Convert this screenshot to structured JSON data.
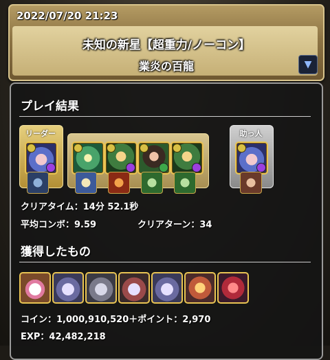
{
  "header": {
    "datetime": "2022/07/20 21:23",
    "dungeon_title": "未知の新星【超重力/ノーコン】",
    "floor_name": "業炎の百龍",
    "expand_icon": "triangle-down-icon"
  },
  "result": {
    "section_title": "プレイ結果",
    "leader_tag": "リーダー",
    "helper_tag": "助っ人",
    "clear_time": "クリアタイム：14分 52.1秒",
    "avg_combo": "平均コンボ：9.59",
    "clear_turns": "クリアターン：34"
  },
  "loot": {
    "section_title": "獲得したもの",
    "coin": "コイン：1,000,910,520＋ポイント：2,970",
    "exp": "EXP：42,482,218"
  },
  "colors": {
    "gold_border": "#e9c453",
    "panel_border": "#9a9a9a",
    "leader_frame": "#c9a64a",
    "helper_frame": "#9d9d9d"
  }
}
